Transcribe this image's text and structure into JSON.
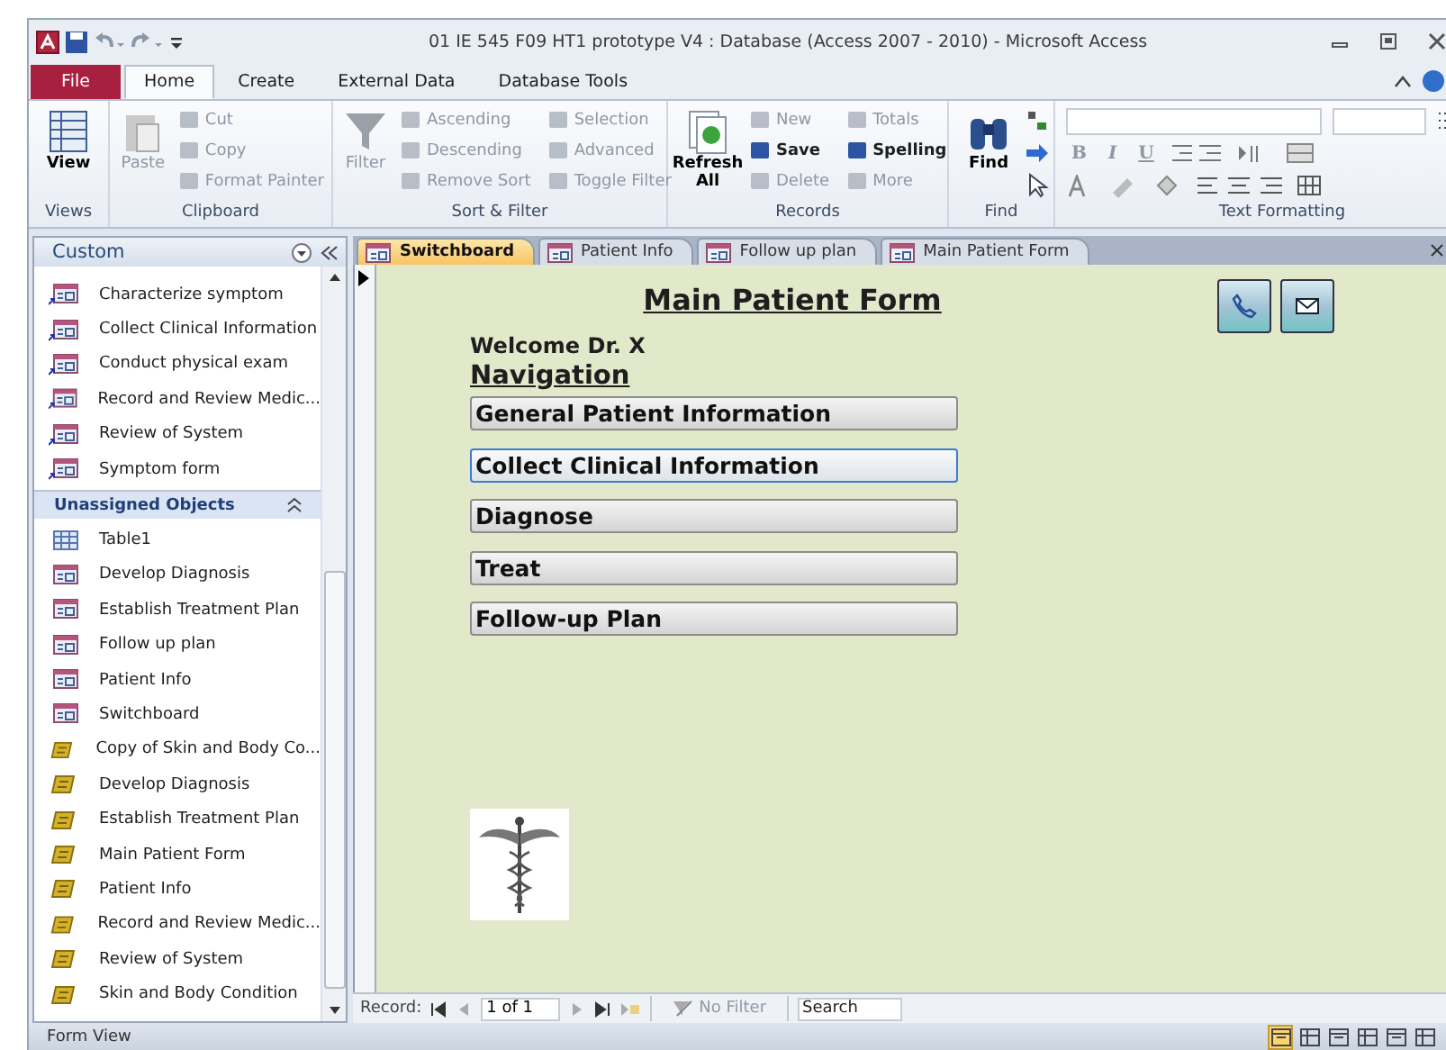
{
  "window": {
    "title": "01 IE 545 F09 HT1 prototype V4 : Database (Access 2007 - 2010)  -  Microsoft Access"
  },
  "ribbon_tabs": [
    {
      "label": "File",
      "kind": "file",
      "selected": false
    },
    {
      "label": "Home",
      "kind": "tab",
      "selected": true
    },
    {
      "label": "Create",
      "kind": "tab",
      "selected": false
    },
    {
      "label": "External Data",
      "kind": "tab",
      "selected": false
    },
    {
      "label": "Database Tools",
      "kind": "tab",
      "selected": false
    }
  ],
  "ribbon_groups": [
    {
      "name": "Views",
      "large": [
        {
          "label": "View",
          "disabled": false
        }
      ]
    },
    {
      "name": "Clipboard",
      "large": [
        {
          "label": "Paste",
          "disabled": true
        }
      ],
      "small": [
        {
          "label": "Cut",
          "disabled": true
        },
        {
          "label": "Copy",
          "disabled": true
        },
        {
          "label": "Format Painter",
          "disabled": true
        }
      ]
    },
    {
      "name": "Sort & Filter",
      "large": [
        {
          "label": "Filter",
          "disabled": true
        }
      ],
      "small": [
        {
          "label": "Ascending",
          "disabled": true
        },
        {
          "label": "Descending",
          "disabled": true
        },
        {
          "label": "Remove Sort",
          "disabled": true
        },
        {
          "label": "Selection",
          "disabled": true
        },
        {
          "label": "Advanced",
          "disabled": true
        },
        {
          "label": "Toggle Filter",
          "disabled": true
        }
      ]
    },
    {
      "name": "Records",
      "large": [
        {
          "label": "Refresh All",
          "disabled": false
        }
      ],
      "small": [
        {
          "label": "New",
          "disabled": true
        },
        {
          "label": "Save",
          "disabled": false
        },
        {
          "label": "Delete",
          "disabled": true
        },
        {
          "label": "Totals",
          "disabled": true
        },
        {
          "label": "Spelling",
          "disabled": false
        },
        {
          "label": "More",
          "disabled": true
        }
      ]
    },
    {
      "name": "Find",
      "large": [
        {
          "label": "Find",
          "disabled": false
        }
      ]
    },
    {
      "name": "Text Formatting",
      "small": [
        {
          "label": "B",
          "disabled": true
        },
        {
          "label": "I",
          "disabled": true
        },
        {
          "label": "U",
          "disabled": true
        }
      ]
    }
  ],
  "nav_pane": {
    "title": "Custom",
    "groups": [
      {
        "items": [
          {
            "label": "Characterize symptom",
            "kind": "form",
            "shortcut": true
          },
          {
            "label": "Collect Clinical Information",
            "kind": "form",
            "shortcut": true
          },
          {
            "label": "Conduct physical exam",
            "kind": "form",
            "shortcut": true
          },
          {
            "label": "Record and Review Medic...",
            "kind": "form",
            "shortcut": true
          },
          {
            "label": "Review of System",
            "kind": "form",
            "shortcut": true
          },
          {
            "label": "Symptom form",
            "kind": "form",
            "shortcut": true
          }
        ]
      },
      {
        "header": "Unassigned Objects",
        "expanded": true,
        "items": [
          {
            "label": "Table1",
            "kind": "table",
            "shortcut": false
          },
          {
            "label": "Develop Diagnosis",
            "kind": "form",
            "shortcut": false
          },
          {
            "label": "Establish Treatment Plan",
            "kind": "form",
            "shortcut": false
          },
          {
            "label": "Follow up plan",
            "kind": "form",
            "shortcut": false
          },
          {
            "label": "Patient Info",
            "kind": "form",
            "shortcut": false
          },
          {
            "label": "Switchboard",
            "kind": "form",
            "shortcut": false
          },
          {
            "label": "Copy of Skin and Body Co...",
            "kind": "report",
            "shortcut": false
          },
          {
            "label": "Develop Diagnosis",
            "kind": "report",
            "shortcut": false
          },
          {
            "label": "Establish Treatment Plan",
            "kind": "report",
            "shortcut": false
          },
          {
            "label": "Main Patient Form",
            "kind": "report",
            "shortcut": false
          },
          {
            "label": "Patient Info",
            "kind": "report",
            "shortcut": false
          },
          {
            "label": "Record and Review Medic...",
            "kind": "report",
            "shortcut": false
          },
          {
            "label": "Review of System",
            "kind": "report",
            "shortcut": false
          },
          {
            "label": "Skin and Body Condition",
            "kind": "report",
            "shortcut": false
          }
        ]
      }
    ]
  },
  "document_tabs": [
    {
      "label": "Switchboard",
      "selected": true
    },
    {
      "label": "Patient Info",
      "selected": false
    },
    {
      "label": "Follow up plan",
      "selected": false
    },
    {
      "label": "Main Patient Form",
      "selected": false
    }
  ],
  "form": {
    "title": "Main Patient Form",
    "welcome": "Welcome Dr. X",
    "section": "Navigation",
    "buttons": [
      {
        "label": "General Patient Information",
        "selected": false
      },
      {
        "label": "Collect Clinical Information",
        "selected": true
      },
      {
        "label": "Diagnose",
        "selected": false
      },
      {
        "label": "Treat",
        "selected": false
      },
      {
        "label": "Follow-up Plan",
        "selected": false
      }
    ]
  },
  "record_nav": {
    "label": "Record:",
    "position": "1 of 1",
    "filter": "No Filter",
    "search_placeholder": "Search"
  },
  "status_bar": {
    "text": "Form View",
    "views": [
      {
        "selected": true
      },
      {
        "selected": false
      },
      {
        "selected": false
      },
      {
        "selected": false
      },
      {
        "selected": false
      },
      {
        "selected": false
      }
    ]
  }
}
